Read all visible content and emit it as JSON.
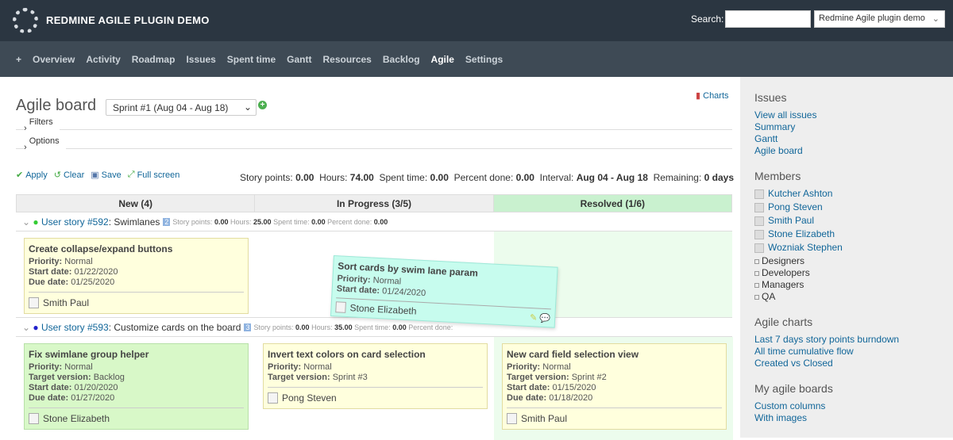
{
  "header": {
    "title": "REDMINE AGILE PLUGIN DEMO",
    "search_label": "Search:",
    "search_value": "",
    "project": "Redmine Agile plugin demo"
  },
  "nav": {
    "items": [
      "+",
      "Overview",
      "Activity",
      "Roadmap",
      "Issues",
      "Spent time",
      "Gantt",
      "Resources",
      "Backlog",
      "Agile",
      "Settings"
    ],
    "selected": "Agile"
  },
  "page": {
    "title": "Agile board",
    "sprint": "Sprint #1 (Aug 04 - Aug 18)",
    "charts_link": "Charts",
    "filters": "Filters",
    "options": "Options",
    "actions": {
      "apply": "Apply",
      "clear": "Clear",
      "save": "Save",
      "fullscreen": "Full screen"
    },
    "totals": [
      {
        "label": "Story points:",
        "value": "0.00"
      },
      {
        "label": "Hours:",
        "value": "74.00"
      },
      {
        "label": "Spent time:",
        "value": "0.00"
      },
      {
        "label": "Percent done:",
        "value": "0.00"
      },
      {
        "label": "Interval:",
        "value": "Aug 04 - Aug 18"
      },
      {
        "label": "Remaining:",
        "value": "0 days"
      }
    ]
  },
  "board": {
    "columns": [
      "New (4)",
      "In Progress (3/5)",
      "Resolved (1/6)"
    ],
    "lanes": [
      {
        "link": "User story #592",
        "title": ": Swimlanes",
        "badge": "2",
        "sp": "0.00",
        "hours": "25.00",
        "spent": "0.00",
        "pct": "0.00"
      },
      {
        "link": "User story #593",
        "title": ": Customize cards on the board",
        "badge": "3",
        "sp": "0.00",
        "hours": "35.00",
        "spent": "0.00",
        "pct": ""
      }
    ],
    "labels": {
      "sp": "Story points:",
      "hours": "Hours:",
      "spent": "Spent time:",
      "pct": "Percent done:"
    },
    "cards": [
      {
        "title": "Create collapse/expand buttons",
        "priority": "Normal",
        "start": "01/22/2020",
        "due": "01/25/2020",
        "assignee": "Smith Paul"
      },
      {
        "title": "Sort cards by swim lane param",
        "priority": "Normal",
        "start": "01/24/2020",
        "assignee": "Stone Elizabeth"
      },
      {
        "title": "Fix swimlane group helper",
        "priority": "Normal",
        "version": "Backlog",
        "start": "01/20/2020",
        "due": "01/27/2020",
        "assignee": "Stone Elizabeth"
      },
      {
        "title": "Invert text colors on card selection",
        "priority": "Normal",
        "version": "Sprint #3",
        "assignee": "Pong Steven"
      },
      {
        "title": "New card field selection view",
        "priority": "Normal",
        "version": "Sprint #2",
        "start": "01/15/2020",
        "due": "01/18/2020",
        "assignee": "Smith Paul"
      }
    ],
    "field_labels": {
      "priority": "Priority:",
      "version": "Target version:",
      "start": "Start date:",
      "due": "Due date:"
    }
  },
  "sidebar": {
    "issues_title": "Issues",
    "issues": [
      "View all issues",
      "Summary",
      "Gantt",
      "Agile board"
    ],
    "members_title": "Members",
    "members": [
      "Kutcher Ashton",
      "Pong Steven",
      "Smith Paul",
      "Stone Elizabeth",
      "Wozniak Stephen"
    ],
    "groups": [
      "Designers",
      "Developers",
      "Managers",
      "QA"
    ],
    "charts_title": "Agile charts",
    "charts": [
      "Last 7 days story points burndown",
      "All time cumulative flow",
      "Created vs Closed"
    ],
    "boards_title": "My agile boards",
    "boards": [
      "Custom columns",
      "With images"
    ]
  },
  "colors": {
    "header": "#2b3641",
    "nav": "#3e4a55",
    "resolved": "#c9f1cf",
    "card": "#ffffdd",
    "card_green": "#d8f8c8",
    "card_drag": "#c7fcee",
    "link": "#116699"
  }
}
